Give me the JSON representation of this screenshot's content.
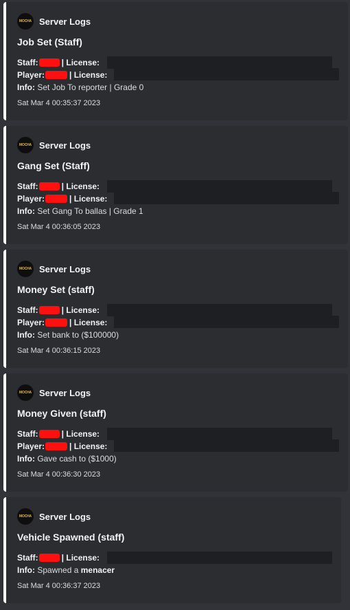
{
  "embeds": [
    {
      "author": "Server Logs",
      "avatar_text": "MOCHA",
      "title": "Job Set (Staff)",
      "staff_label": "Staff:",
      "license_label": "| License:",
      "player_label": "Player:",
      "info_label": "Info:",
      "info_text": "Set Job To reporter | Grade 0",
      "timestamp": "Sat Mar  4 00:35:37 2023"
    },
    {
      "author": "Server Logs",
      "avatar_text": "MOCHA",
      "title": "Gang Set (Staff)",
      "staff_label": "Staff:",
      "license_label": "| License:",
      "player_label": "Player:",
      "info_label": "Info:",
      "info_text": "Set Gang To ballas | Grade 1",
      "timestamp": "Sat Mar  4 00:36:05 2023"
    },
    {
      "author": "Server Logs",
      "avatar_text": "MOCHA",
      "title": "Money Set (staff)",
      "staff_label": "Staff:",
      "license_label": "| License:",
      "player_label": "Player:",
      "info_label": "Info:",
      "info_text": "Set bank to ($100000)",
      "timestamp": "Sat Mar  4 00:36:15 2023"
    },
    {
      "author": "Server Logs",
      "avatar_text": "MOCHA",
      "title": "Money Given (staff)",
      "staff_label": "Staff:",
      "license_label": "| License:",
      "player_label": "Player:",
      "info_label": "Info:",
      "info_text": "Gave cash to ($1000)",
      "timestamp": "Sat Mar  4 00:36:30 2023"
    },
    {
      "author": "Server Logs",
      "avatar_text": "MOCHA",
      "title": "Vehicle Spawned (staff)",
      "staff_label": "Staff:",
      "license_label": "| License:",
      "info_label": "Info:",
      "info_text": "Spawned a",
      "info_bold": "menacer",
      "timestamp": "Sat Mar  4 00:36:37 2023"
    }
  ]
}
